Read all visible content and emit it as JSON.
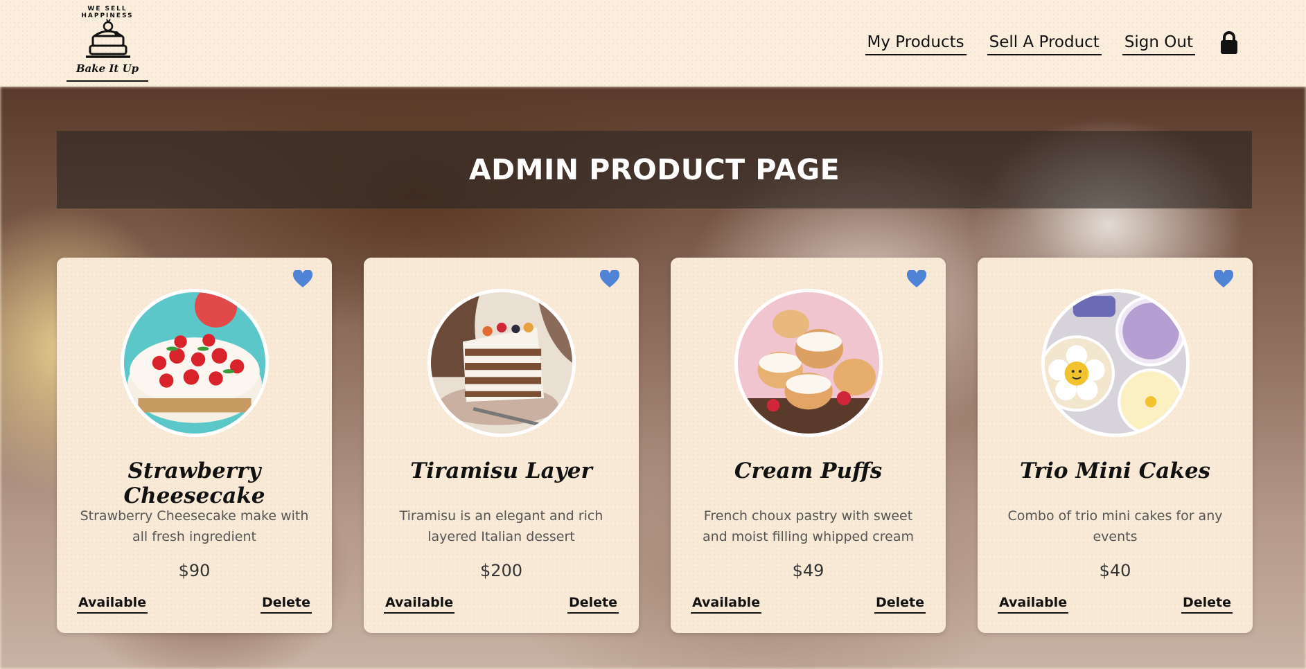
{
  "brand": {
    "tagline": "WE SELL HAPPINESS",
    "name": "Bake It Up"
  },
  "nav": {
    "items": [
      "My Products",
      "Sell A Product",
      "Sign Out"
    ],
    "lock_icon": "lock-icon"
  },
  "page": {
    "title": "ADMIN PRODUCT PAGE"
  },
  "products": [
    {
      "name": "Strawberry Cheesecake",
      "description": "Strawberry Cheesecake make with all fresh ingredient",
      "price": "$90",
      "status": "Available",
      "delete_label": "Delete"
    },
    {
      "name": "Tiramisu Layer",
      "description": "Tiramisu is an elegant and rich layered Italian dessert",
      "price": "$200",
      "status": "Available",
      "delete_label": "Delete"
    },
    {
      "name": "Cream Puffs",
      "description": "French choux pastry with sweet and moist filling whipped cream",
      "price": "$49",
      "status": "Available",
      "delete_label": "Delete"
    },
    {
      "name": "Trio Mini Cakes",
      "description": "Combo of trio mini cakes for any events",
      "price": "$40",
      "status": "Available",
      "delete_label": "Delete"
    }
  ],
  "colors": {
    "heart": "#4f83d6",
    "header_bg": "#fbeedd",
    "card_bg": "#f8ead6",
    "banner_bg": "rgba(45,38,35,0.62)"
  }
}
